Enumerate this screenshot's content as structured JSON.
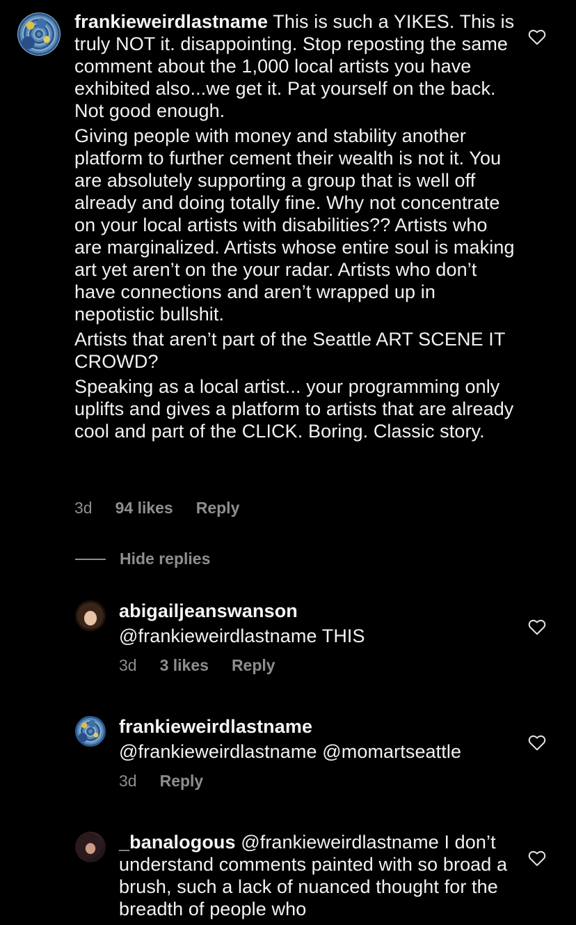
{
  "main_comment": {
    "username": "frankieweirdlastname",
    "paragraphs": [
      "This is such a YIKES. This is truly NOT it. disappointing. Stop reposting the same comment about the 1,000 local artists you have exhibited also...we get it. Pat yourself on the back. Not good enough.",
      "Giving people with money and stability another platform to further cement their wealth is not it. You are absolutely supporting a group that is well off already and doing totally fine. Why not concentrate on your local artists with disabilities?? Artists who are marginalized. Artists whose entire soul is making art yet aren’t on the your radar. Artists who don’t have connections and aren’t wrapped up in nepotistic bullshit.",
      "Artists that aren’t part of the Seattle  ART SCENE IT CROWD?",
      "Speaking as a local artist... your programming only uplifts and gives a platform to artists that are already cool and part of the CLICK. Boring. Classic story."
    ],
    "time": "3d",
    "likes": "94 likes",
    "reply_label": "Reply"
  },
  "hide_replies_label": "Hide replies",
  "replies": [
    {
      "username": "abigailjeanswanson",
      "text": "@frankieweirdlastname THIS",
      "time": "3d",
      "likes": "3 likes",
      "reply_label": "Reply"
    },
    {
      "username": "frankieweirdlastname",
      "text": "@frankieweirdlastname @momartseattle",
      "time": "3d",
      "reply_label": "Reply"
    },
    {
      "username": "_banalogous",
      "text": "@frankieweirdlastname I don’t understand comments painted with so broad a brush, such a lack of nuanced thought for the breadth of people who"
    }
  ],
  "icons": {
    "like": "heart-outline-icon"
  },
  "colors": {
    "background": "#000000",
    "text": "#f2f2f2",
    "secondary": "#8e8e8e"
  }
}
